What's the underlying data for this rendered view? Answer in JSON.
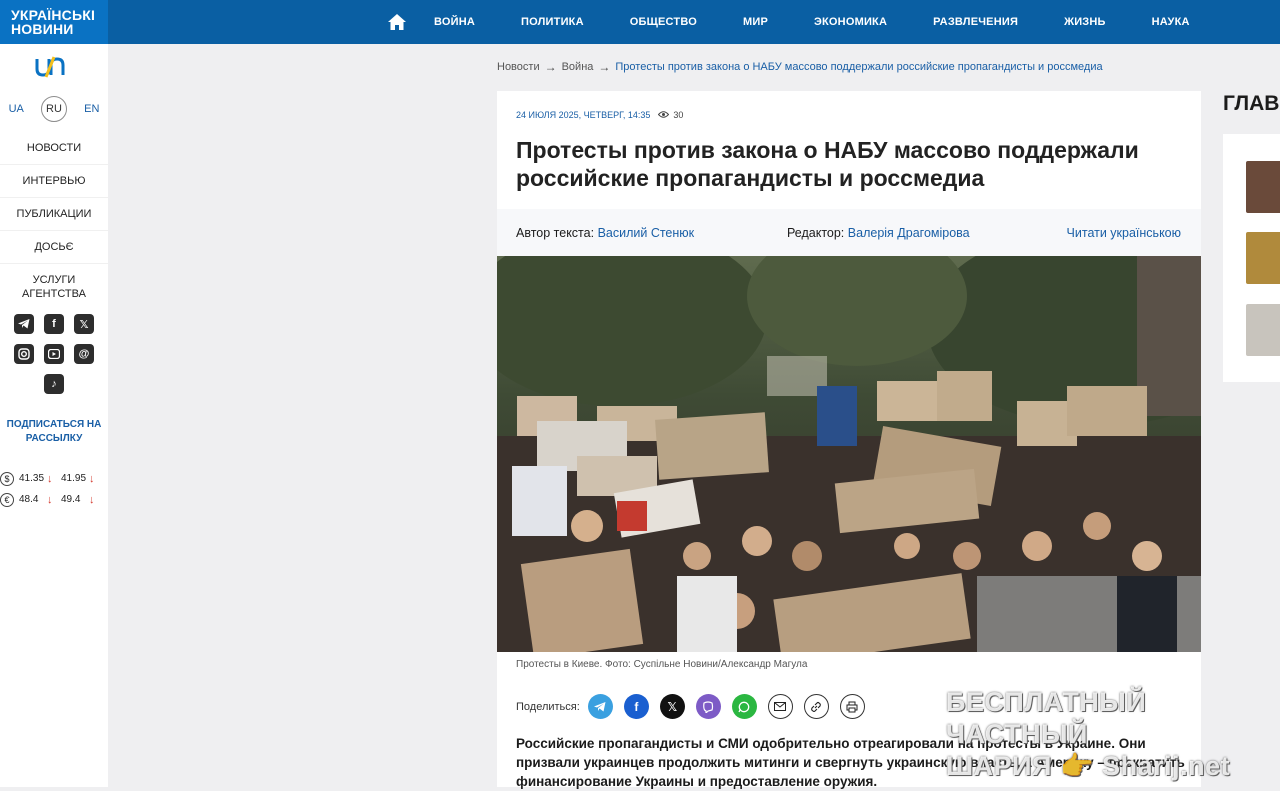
{
  "brand": {
    "title_line1": "УКРАЇНСЬКІ",
    "title_line2": "НОВИНИ",
    "logo_text": "un"
  },
  "languages": [
    "UA",
    "RU",
    "EN"
  ],
  "sidebar_nav": [
    "НОВОСТИ",
    "ИНТЕРВЬЮ",
    "ПУБЛИКАЦИИ",
    "ДОСЬЄ",
    "УСЛУГИ АГЕНТСТВА"
  ],
  "socials": [
    "telegram-icon",
    "facebook-icon",
    "x-icon",
    "instagram-icon",
    "youtube-icon",
    "threads-icon",
    "tiktok-icon"
  ],
  "subscribe": "ПОДПИСАТЬСЯ НА РАССЫЛКУ",
  "rates": [
    {
      "currency": "$",
      "buy": "41.35",
      "sell": "41.95"
    },
    {
      "currency": "€",
      "buy": "48.4",
      "sell": "49.4"
    }
  ],
  "top_nav": [
    "ВОЙНА",
    "ПОЛИТИКА",
    "ОБЩЕСТВО",
    "МИР",
    "ЭКОНОМИКА",
    "РАЗВЛЕЧЕНИЯ",
    "ЖИЗНЬ",
    "НАУКА"
  ],
  "breadcrumbs": [
    "Новости",
    "Война",
    "Протесты против закона о НАБУ массово поддержали российские пропагандисты и россмедиа"
  ],
  "article": {
    "date": "24 ИЮЛЯ 2025, ЧЕТВЕРГ, 14:35",
    "views": "30",
    "title": "Протесты против закона о НАБУ массово поддержали российские пропагандисты и россмедиа",
    "author_label": "Автор текста:",
    "author": "Василий Стенюк",
    "editor_label": "Редактор:",
    "editor": "Валерія Драгомірова",
    "read_ua": "Читати українською",
    "caption": "Протесты в Киеве. Фото: Суспільне Новини/Александр Магула",
    "share_label": "Поделиться:",
    "lead": "Российские пропагандисты и СМИ одобрительно отреагировали на протесты в Украине. Они призвали украинцев продолжить митинги и свергнуть украинскую власть, а Америку – прекратить финансирование Украины и предоставление оружия."
  },
  "share_buttons": [
    {
      "icon": "telegram-icon",
      "color": "#3aa0e0"
    },
    {
      "icon": "facebook-icon",
      "color": "#1a5fd0"
    },
    {
      "icon": "x-icon",
      "color": "#111111"
    },
    {
      "icon": "viber-icon",
      "color": "#7d5bc6"
    },
    {
      "icon": "whatsapp-icon",
      "color": "#2bb741"
    },
    {
      "icon": "mail-icon",
      "color": "#ffffff"
    },
    {
      "icon": "link-icon",
      "color": "#ffffff"
    },
    {
      "icon": "print-icon",
      "color": "#ffffff"
    }
  ],
  "right_column": {
    "heading": "ГЛАВ"
  },
  "watermark": {
    "line1": "БЕСПЛАТНЫЙ ЧАСТНЫЙ",
    "line2": "ШАРИЯ",
    "line2b": "Sharij.net"
  },
  "colors": {
    "accent": "#0a5fa3",
    "brand": "#0a72c3",
    "link": "#1a5fa6",
    "down": "#d43a2f"
  }
}
